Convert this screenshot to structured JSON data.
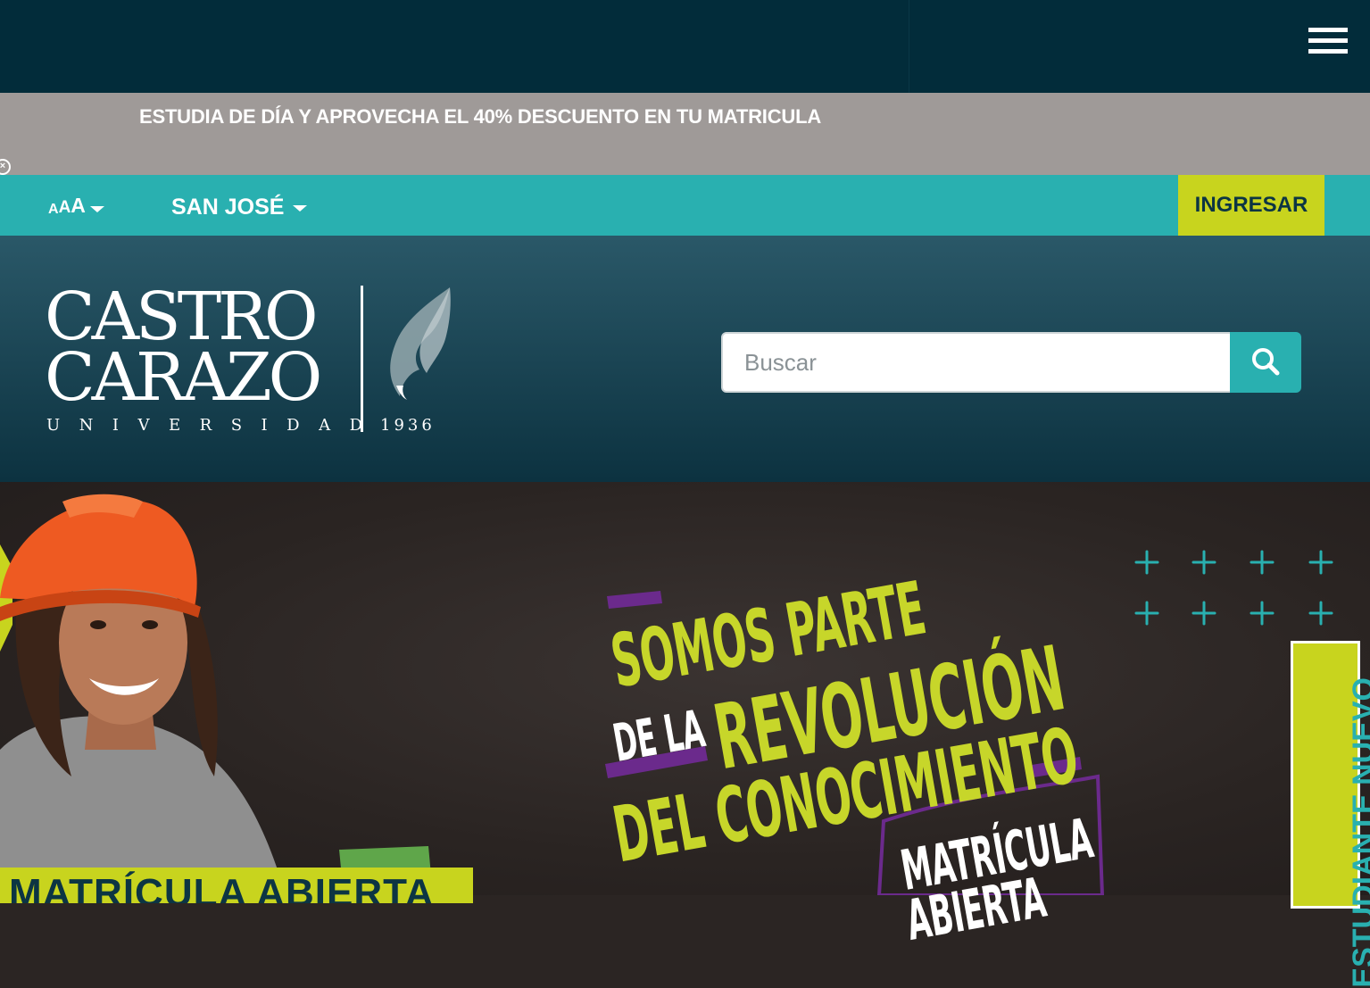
{
  "header_bar": {
    "menu_icon": "hamburger-icon"
  },
  "promo": {
    "text": "ESTUDIA DE DÍA Y APROVECHA EL 40% DESCUENTO EN TU MATRICULA",
    "close_icon": "close-circle-icon"
  },
  "utility": {
    "font_size_label": [
      "A",
      "A",
      "A"
    ],
    "city": "SAN JOSÉ",
    "login_button": "INGRESAR"
  },
  "logo": {
    "line1": "CASTRO",
    "line2": "CARAZO",
    "line3": "UNIVERSIDAD",
    "year": "1936",
    "icon": "flame-icon"
  },
  "search": {
    "placeholder": "Buscar",
    "icon": "search-icon"
  },
  "hero": {
    "line1": "SOMOS PARTE",
    "line2": "DE LA",
    "line3": "REVOLUCIÓN",
    "line4": "DEL CONOCIMIENTO",
    "badge_line1": "MATRÍCULA",
    "badge_line2": "ABIERTA",
    "side_tab": "ESTUDIANTE NUEVO",
    "bottom_banner": "MATRÍCULA ABIERTA"
  },
  "colors": {
    "top_bar": "#022c3a",
    "promo_bar": "#9f9a98",
    "teal": "#29b0b0",
    "lime": "#c8d41e",
    "header_gradient_top": "#2a5868",
    "header_gradient_bottom": "#0c3240",
    "hero_background": "#2b2523",
    "purple_accent": "#6b2a8c"
  }
}
